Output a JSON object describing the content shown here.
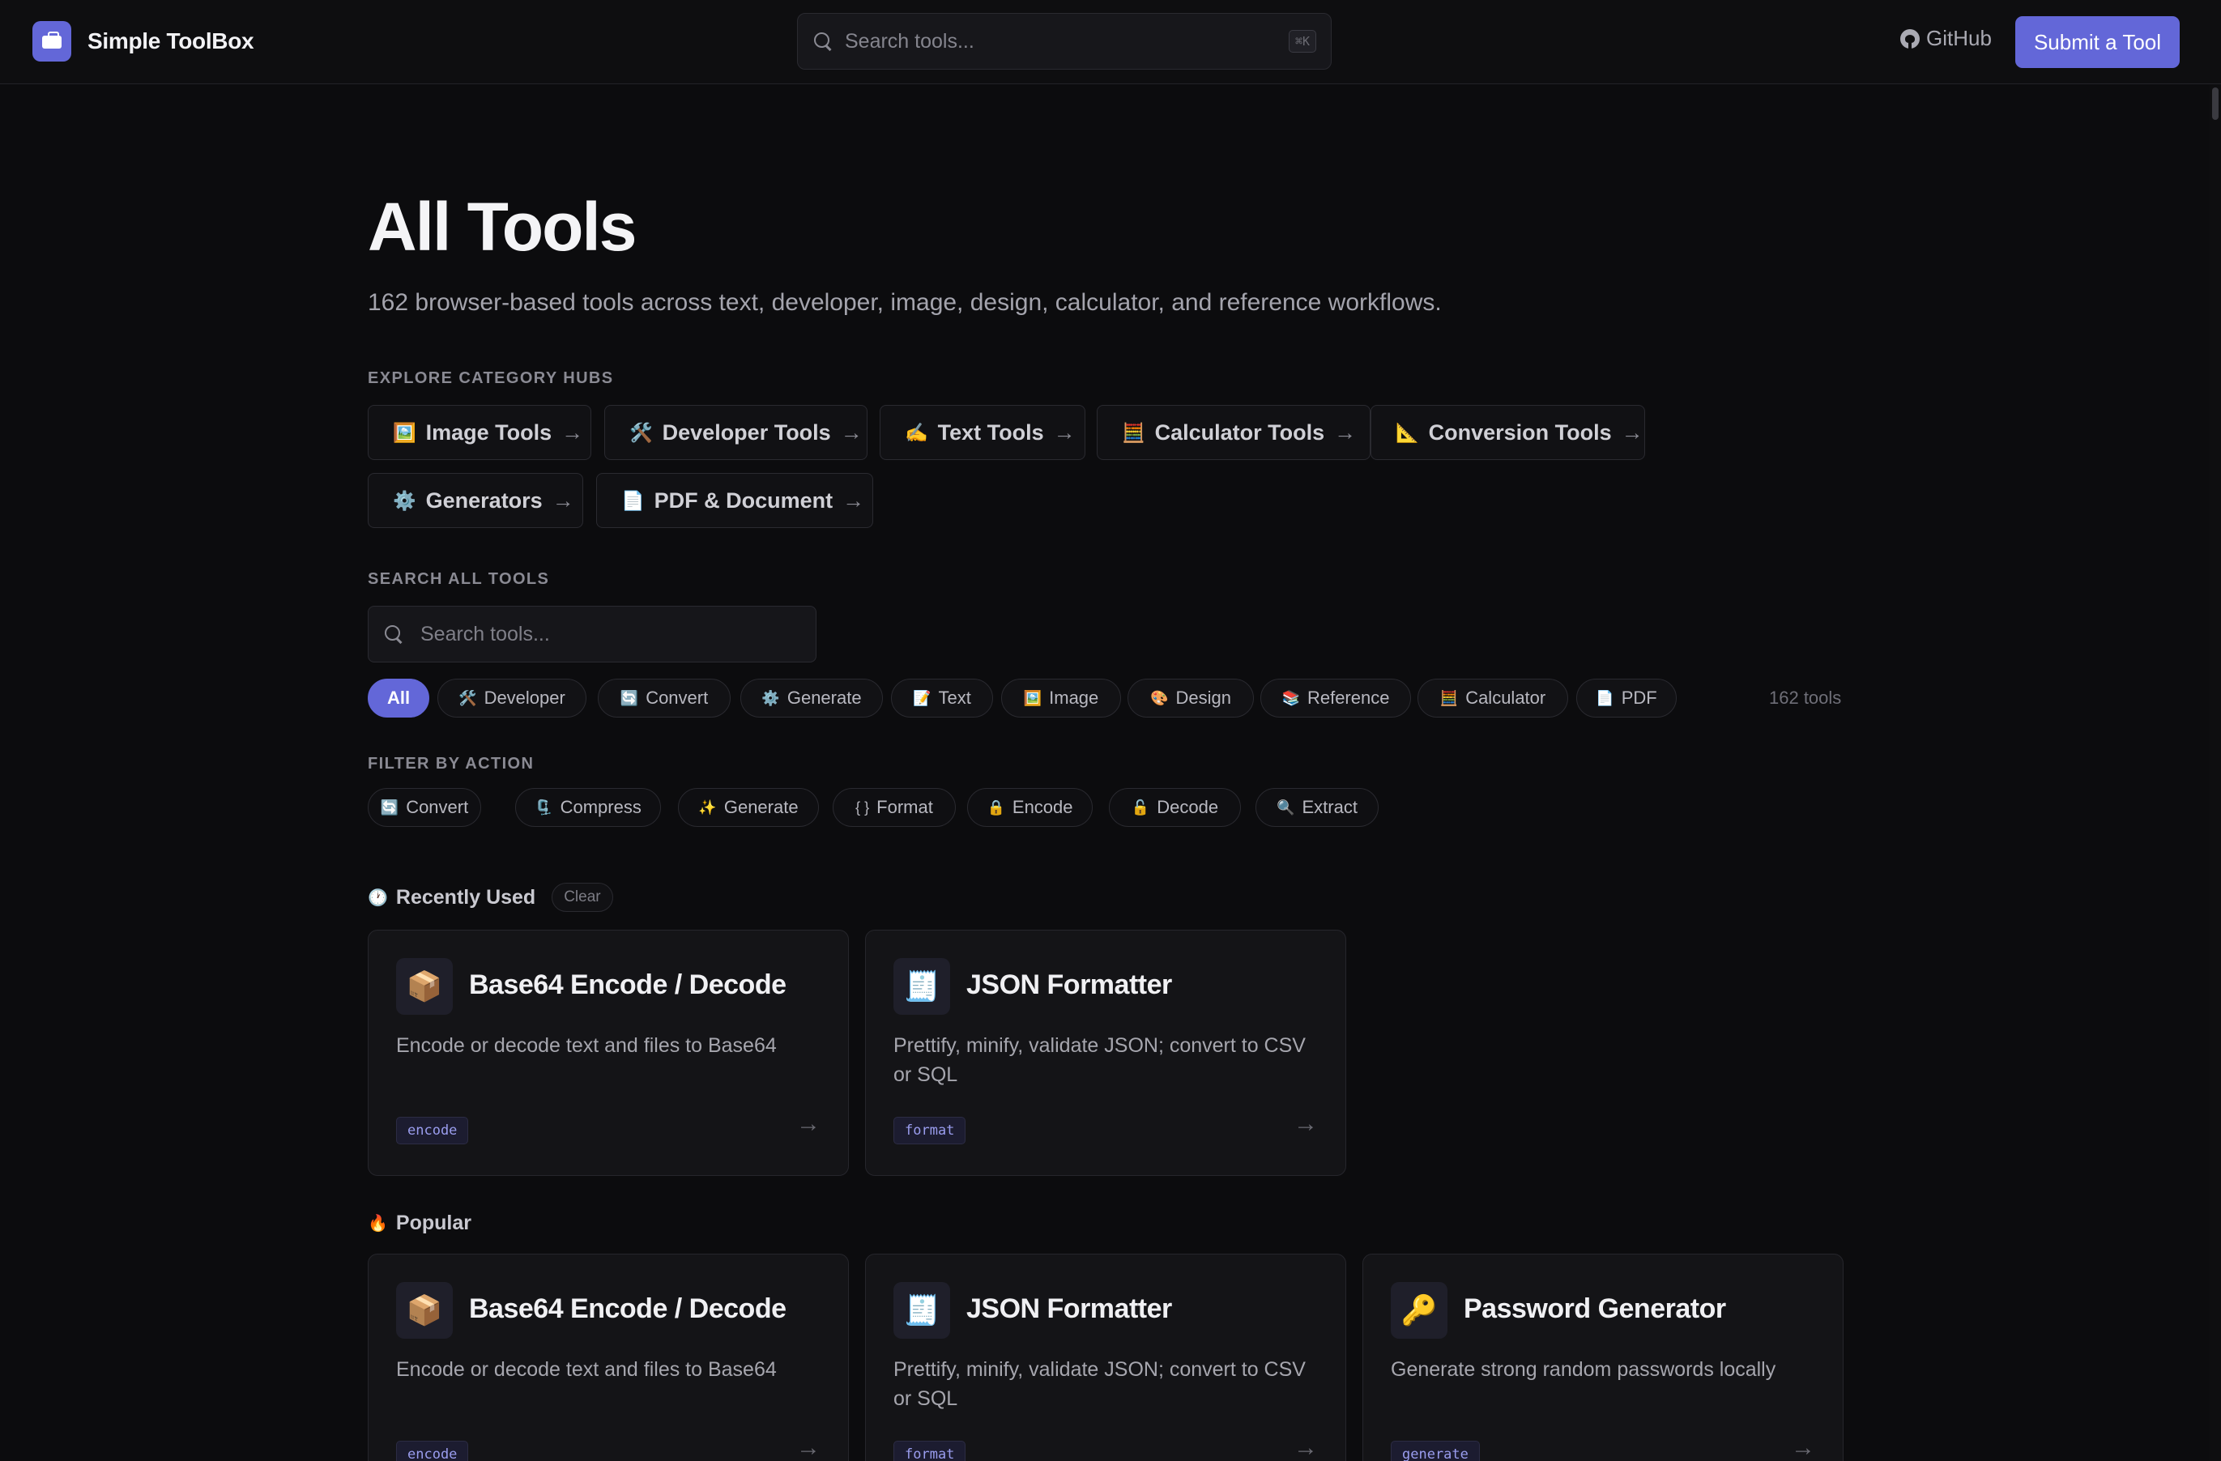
{
  "header": {
    "brand_name": "Simple ToolBox",
    "search_placeholder": "Search tools...",
    "search_shortcut": "⌘K",
    "github_label": "GitHub",
    "submit_label": "Submit a Tool"
  },
  "page": {
    "title": "All Tools",
    "subtitle": "162 browser-based tools across text, developer, image, design, calculator, and reference workflows."
  },
  "hubs": {
    "label": "EXPLORE CATEGORY HUBS",
    "items": [
      {
        "emoji": "🖼️",
        "label": "Image Tools",
        "arrow": "→"
      },
      {
        "emoji": "🛠️",
        "label": "Developer Tools",
        "arrow": "→"
      },
      {
        "emoji": "✍️",
        "label": "Text Tools",
        "arrow": "→"
      },
      {
        "emoji": "🧮",
        "label": "Calculator Tools",
        "arrow": "→"
      },
      {
        "emoji": "📐",
        "label": "Conversion Tools",
        "arrow": "→"
      },
      {
        "emoji": "⚙️",
        "label": "Generators",
        "arrow": "→"
      },
      {
        "emoji": "📄",
        "label": "PDF & Document",
        "arrow": "→"
      }
    ]
  },
  "search_all": {
    "label": "SEARCH ALL TOOLS",
    "placeholder": "Search tools..."
  },
  "categories": {
    "items": [
      {
        "emoji": "",
        "label": "All"
      },
      {
        "emoji": "🛠️",
        "label": "Developer"
      },
      {
        "emoji": "🔄",
        "label": "Convert"
      },
      {
        "emoji": "⚙️",
        "label": "Generate"
      },
      {
        "emoji": "📝",
        "label": "Text"
      },
      {
        "emoji": "🖼️",
        "label": "Image"
      },
      {
        "emoji": "🎨",
        "label": "Design"
      },
      {
        "emoji": "📚",
        "label": "Reference"
      },
      {
        "emoji": "🧮",
        "label": "Calculator"
      },
      {
        "emoji": "📄",
        "label": "PDF"
      }
    ],
    "count_label": "162 tools"
  },
  "actions": {
    "label": "FILTER BY ACTION",
    "items": [
      {
        "emoji": "🔄",
        "label": "Convert"
      },
      {
        "emoji": "🗜️",
        "label": "Compress"
      },
      {
        "emoji": "✨",
        "label": "Generate"
      },
      {
        "emoji": "{ }",
        "label": "Format"
      },
      {
        "emoji": "🔒",
        "label": "Encode"
      },
      {
        "emoji": "🔓",
        "label": "Decode"
      },
      {
        "emoji": "🔍",
        "label": "Extract"
      }
    ]
  },
  "recent": {
    "emoji": "🕐",
    "title": "Recently Used",
    "clear_label": "Clear",
    "cards": [
      {
        "emoji": "📦",
        "title": "Base64 Encode / Decode",
        "desc": "Encode or decode text and files to Base64",
        "tag": "encode",
        "arrow": "→"
      },
      {
        "emoji": "🧾",
        "title": "JSON Formatter",
        "desc": "Prettify, minify, validate JSON; convert to CSV or SQL",
        "tag": "format",
        "arrow": "→"
      }
    ]
  },
  "popular": {
    "emoji": "🔥",
    "title": "Popular",
    "cards": [
      {
        "emoji": "📦",
        "title": "Base64 Encode / Decode",
        "desc": "Encode or decode text and files to Base64",
        "tag": "encode",
        "arrow": "→"
      },
      {
        "emoji": "🧾",
        "title": "JSON Formatter",
        "desc": "Prettify, minify, validate JSON; convert to CSV or SQL",
        "tag": "format",
        "arrow": "→"
      },
      {
        "emoji": "🔑",
        "title": "Password Generator",
        "desc": "Generate strong random passwords locally",
        "tag": "generate",
        "arrow": "→"
      }
    ]
  },
  "colors": {
    "accent": "#6367d8",
    "background": "#0c0c0e",
    "card": "#141417"
  }
}
